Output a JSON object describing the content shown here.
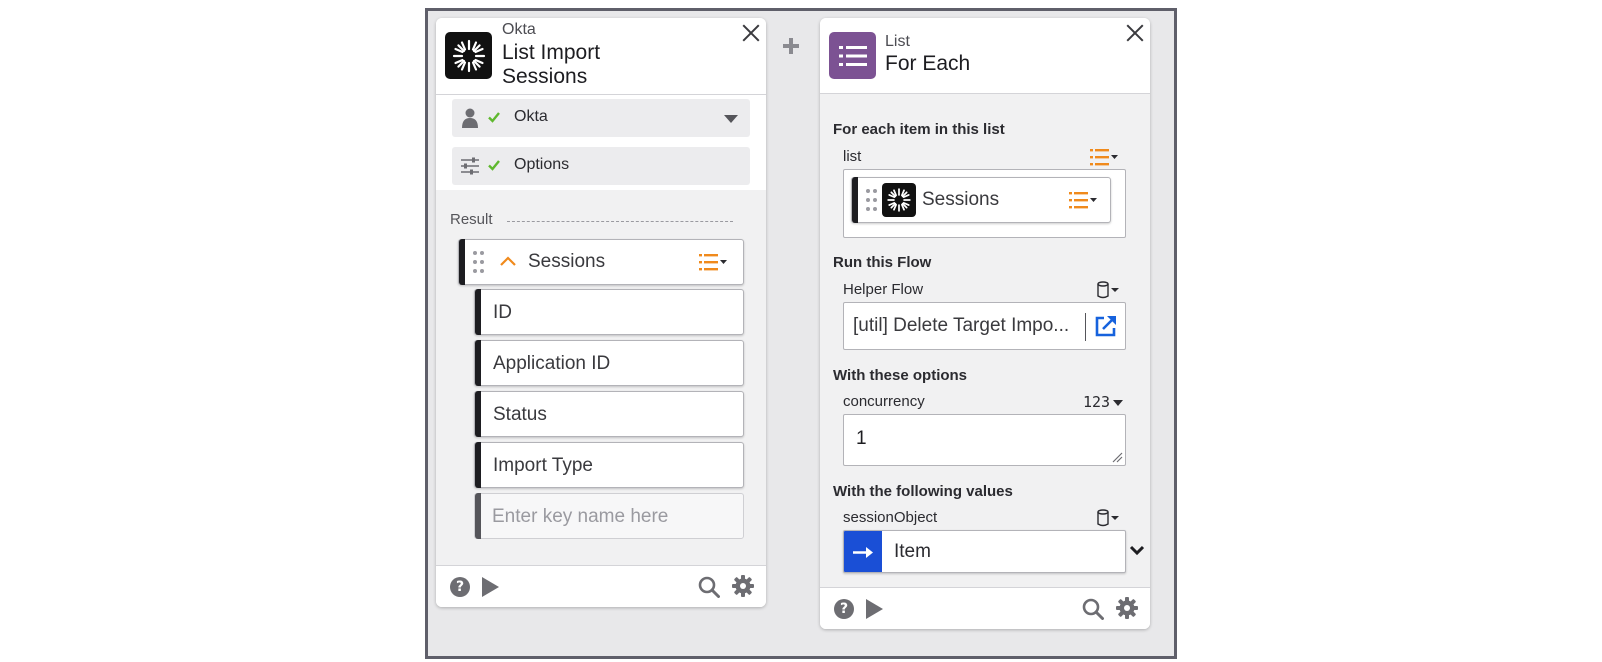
{
  "left_card": {
    "app_name": "Okta",
    "title_line1": "List Import",
    "title_line2": "Sessions",
    "connection_label": "Okta",
    "options_label": "Options",
    "result_label": "Result",
    "result_pill_label": "Sessions",
    "keys": [
      "ID",
      "Application ID",
      "Status",
      "Import Type"
    ],
    "key_placeholder": "Enter key name here"
  },
  "right_card": {
    "app_name": "List",
    "title": "For Each",
    "section_list": "For each item in this list",
    "list_field_label": "list",
    "list_pill_label": "Sessions",
    "section_flow": "Run this Flow",
    "helper_flow_label": "Helper Flow",
    "helper_flow_value": "[util] Delete Target Impo...",
    "section_options": "With these options",
    "concurrency_label": "concurrency",
    "concurrency_type": "123",
    "concurrency_value": "1",
    "section_values": "With the following values",
    "session_object_label": "sessionObject",
    "item_label": "Item"
  },
  "colors": {
    "accent_orange": "#f08a1c",
    "list_purple": "#7c5293",
    "check_green": "#5fb82e",
    "item_blue": "#1a4fd6",
    "link_blue": "#1662dd"
  },
  "icons": {
    "okta": "okta-logo-icon",
    "list": "list-card-icon",
    "add": "plus-icon",
    "user": "user-icon",
    "options": "sliders-icon",
    "check": "check-icon",
    "caret": "caret-down-icon",
    "drag": "drag-handle-icon",
    "collapse": "chevron-up-icon",
    "list_type": "list-type-icon",
    "datatype": "cylinder-icon",
    "external": "external-link-icon",
    "arrow": "arrow-right-icon",
    "help": "help-icon",
    "play": "play-icon",
    "search": "search-icon",
    "gear": "gear-icon",
    "expand": "chevron-down-icon"
  }
}
